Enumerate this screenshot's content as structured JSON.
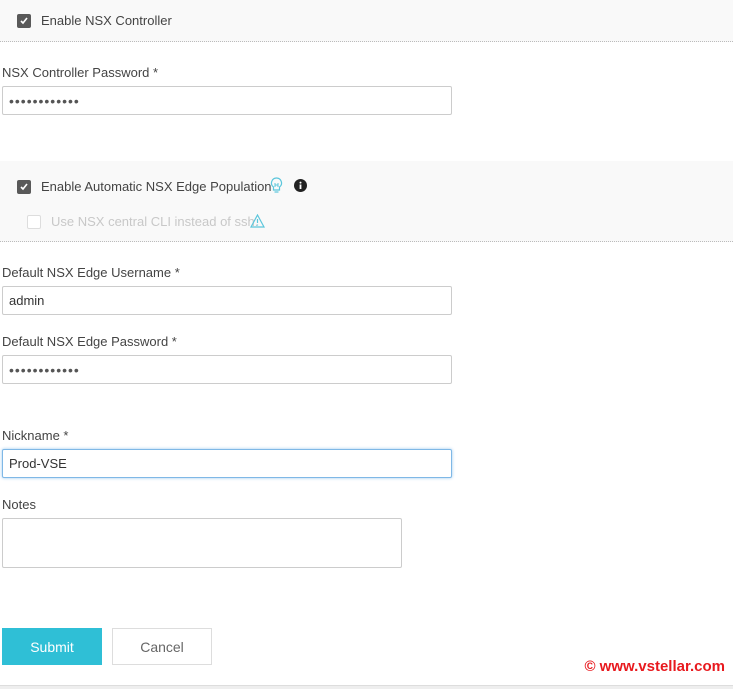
{
  "controller": {
    "enable_label": "Enable NSX Controller",
    "enabled": true,
    "password_label": "NSX Controller Password *",
    "password_value": "••••••••••••"
  },
  "edge": {
    "auto_label": "Enable Automatic NSX Edge Population",
    "auto_enabled": true,
    "cli_label": "Use NSX central CLI instead of ssh.",
    "cli_enabled": false,
    "username_label": "Default NSX Edge Username *",
    "username_value": "admin",
    "password_label": "Default NSX Edge Password *",
    "password_value": "••••••••••••"
  },
  "nickname": {
    "label": "Nickname *",
    "value": "Prod-VSE"
  },
  "notes": {
    "label": "Notes",
    "value": ""
  },
  "buttons": {
    "submit": "Submit",
    "cancel": "Cancel"
  },
  "watermark": "© www.vstellar.com",
  "colors": {
    "accent": "#2fbfd6",
    "watermark": "#e8191e"
  }
}
